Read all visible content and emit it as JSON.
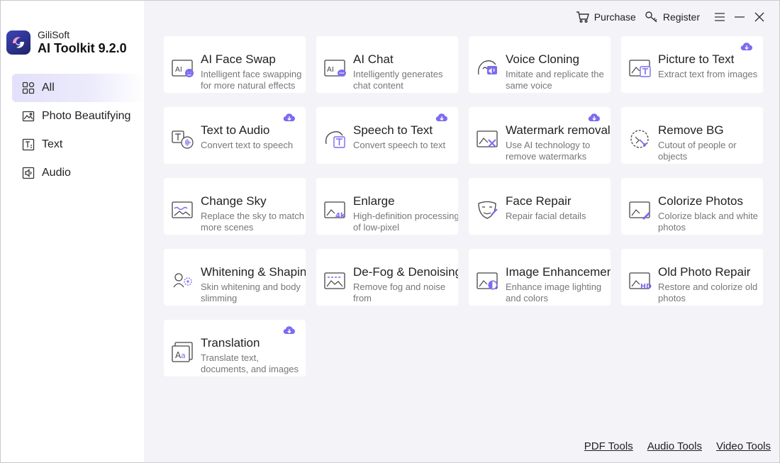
{
  "app": {
    "company": "GiliSoft",
    "product": "AI Toolkit 9.2.0"
  },
  "topbar": {
    "purchase": "Purchase",
    "register": "Register"
  },
  "nav": [
    {
      "label": "All",
      "icon": "grid-icon",
      "active": true
    },
    {
      "label": "Photo Beautifying",
      "icon": "photo-icon",
      "active": false
    },
    {
      "label": "Text",
      "icon": "text-icon",
      "active": false
    },
    {
      "label": "Audio",
      "icon": "audio-icon",
      "active": false
    }
  ],
  "tools": [
    {
      "title": "AI Face Swap",
      "desc": "Intelligent face swapping for more natural effects",
      "icon": "ai-face-swap-icon",
      "download": false
    },
    {
      "title": "AI Chat",
      "desc": "Intelligently generates chat content",
      "icon": "ai-chat-icon",
      "download": false
    },
    {
      "title": "Voice Cloning",
      "desc": "Imitate and replicate the same voice",
      "icon": "voice-cloning-icon",
      "download": false
    },
    {
      "title": "Picture to Text",
      "desc": "Extract text from images",
      "icon": "picture-to-text-icon",
      "download": true
    },
    {
      "title": "Text to Audio",
      "desc": "Convert text to speech",
      "icon": "text-to-audio-icon",
      "download": true
    },
    {
      "title": "Speech to Text",
      "desc": "Convert speech to text",
      "icon": "speech-to-text-icon",
      "download": true
    },
    {
      "title": "Watermark removal",
      "desc": "Use AI technology to remove watermarks",
      "icon": "watermark-removal-icon",
      "download": true
    },
    {
      "title": "Remove BG",
      "desc": "Cutout of people or objects",
      "icon": "remove-bg-icon",
      "download": false
    },
    {
      "title": "Change Sky",
      "desc": "Replace the sky to match more scenes",
      "icon": "change-sky-icon",
      "download": false
    },
    {
      "title": "Enlarge",
      "desc": "High-definition processing of low-pixel",
      "icon": "enlarge-4k-icon",
      "download": false
    },
    {
      "title": "Face Repair",
      "desc": "Repair facial details",
      "icon": "face-repair-icon",
      "download": false
    },
    {
      "title": "Colorize Photos",
      "desc": "Colorize black and white photos",
      "icon": "colorize-photos-icon",
      "download": false
    },
    {
      "title": "Whitening & Shaping",
      "desc": "Skin whitening and body slimming",
      "icon": "whitening-shaping-icon",
      "download": false
    },
    {
      "title": "De-Fog & Denoising",
      "desc": "Remove fog and noise from",
      "icon": "defog-denoising-icon",
      "download": false
    },
    {
      "title": "Image Enhancement",
      "desc": "Enhance image lighting and colors",
      "icon": "image-enhancement-icon",
      "download": false
    },
    {
      "title": "Old Photo Repair",
      "desc": "Restore and colorize old photos",
      "icon": "old-photo-repair-icon",
      "download": false
    },
    {
      "title": "Translation",
      "desc": "Translate text, documents, and images",
      "icon": "translation-icon",
      "download": true
    }
  ],
  "footer": {
    "pdf": "PDF Tools",
    "audio": "Audio Tools",
    "video": "Video Tools"
  },
  "colors": {
    "accent": "#7b6cf0",
    "nav_active": "#e3e0fb",
    "background": "#f4f4f8"
  }
}
